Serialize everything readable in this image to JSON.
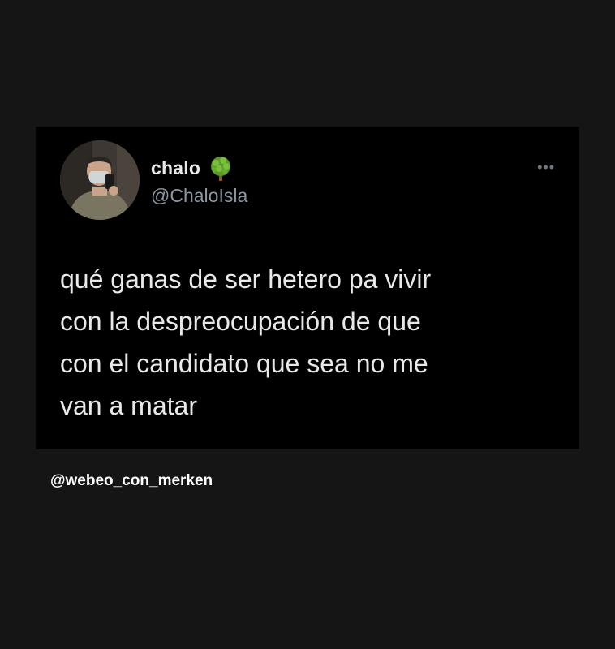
{
  "tweet": {
    "display_name": "chalo",
    "handle": "@ChaloIsla",
    "emoji_icon": "tree-icon",
    "more_icon": "more-horizontal-icon",
    "more_label": "•••",
    "text": "qué ganas de ser hetero pa vivir\ncon la despreocupación de que\ncon el candidato que sea no me\nvan a matar"
  },
  "watermark": {
    "text": "@webeo_con_merken"
  },
  "colors": {
    "page_background": "#151515",
    "card_background": "#000000",
    "primary_text": "#e7e9ea",
    "secondary_text": "#8b98a5",
    "emoji_green": "#7cbf3a"
  }
}
